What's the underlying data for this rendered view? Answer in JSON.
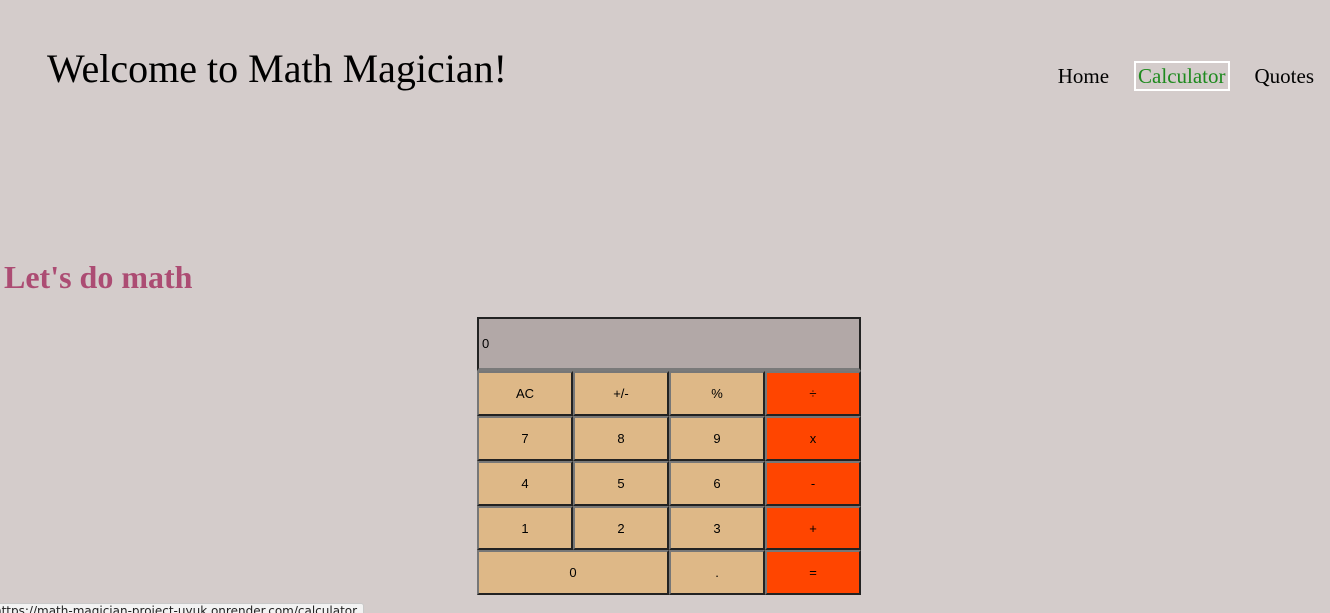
{
  "header": {
    "title": "Welcome to Math Magician!",
    "nav": [
      {
        "label": "Home",
        "active": false
      },
      {
        "label": "Calculator",
        "active": true
      },
      {
        "label": "Quotes",
        "active": false
      }
    ]
  },
  "main": {
    "heading": "Let's do math"
  },
  "calculator": {
    "display": "0",
    "keys": {
      "ac": "AC",
      "sign": "+/-",
      "percent": "%",
      "divide": "÷",
      "seven": "7",
      "eight": "8",
      "nine": "9",
      "multiply": "x",
      "four": "4",
      "five": "5",
      "six": "6",
      "subtract": "-",
      "one": "1",
      "two": "2",
      "three": "3",
      "add": "+",
      "zero": "0",
      "decimal": ".",
      "equals": "="
    },
    "colors": {
      "digit_key": "#deb887",
      "operator_key": "#ff4500",
      "display_bg": "#b2a8a7"
    }
  },
  "statusbar": {
    "url": "https://math-magician-project-uyuk.onrender.com/calculator"
  },
  "colors": {
    "page_bg": "#d4cccb",
    "heading": "#ac4c73",
    "active_nav": "#1e8a1e"
  }
}
